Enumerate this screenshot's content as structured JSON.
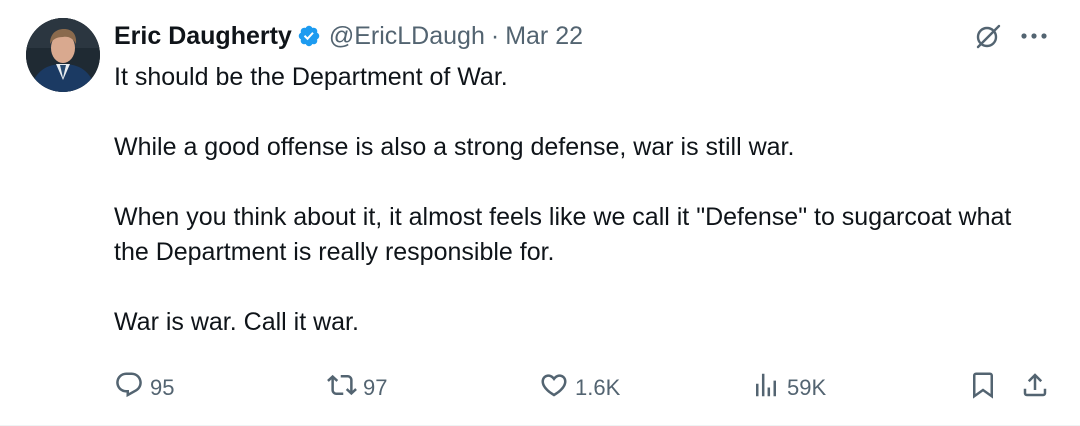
{
  "tweet": {
    "author_name": "Eric Daugherty",
    "handle": "@EricLDaugh",
    "separator": "·",
    "date": "Mar 22",
    "paragraphs": [
      "It should be the Department of War.",
      "While a good offense is also a strong defense, war is still war.",
      "When you think about it, it almost feels like we call it \"Defense\" to sugarcoat what the Department is really responsible for.",
      "War is war. Call it war."
    ]
  },
  "actions": {
    "replies": "95",
    "reposts": "97",
    "likes": "1.6K",
    "views": "59K"
  },
  "icons": {
    "verified": "verified-badge-icon",
    "grok": "grok-icon",
    "more": "more-icon",
    "reply": "reply-icon",
    "repost": "repost-icon",
    "like": "heart-icon",
    "views": "analytics-icon",
    "bookmark": "bookmark-icon",
    "share": "share-icon"
  },
  "colors": {
    "text": "#0f1419",
    "secondary": "#536471",
    "verified": "#1d9bf0"
  }
}
